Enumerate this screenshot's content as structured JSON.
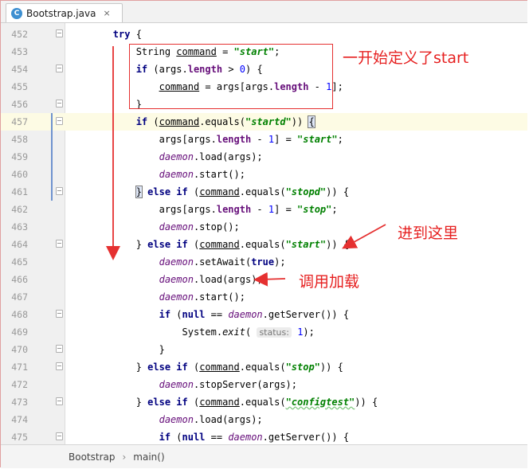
{
  "tab": {
    "title": "Bootstrap.java",
    "icon": "C",
    "close": "×"
  },
  "code_lines": [
    {
      "n": "452",
      "html": "        <span class=\"kw\">try</span> {",
      "fold": "open"
    },
    {
      "n": "453",
      "html": "            String <span class=\"u\">command</span> = <span class=\"str\">\"start\"</span>;"
    },
    {
      "n": "454",
      "html": "            <span class=\"kw\">if</span> (args.<span class=\"fld\">length</span> &gt; <span class=\"num\">0</span>) {",
      "fold": "open"
    },
    {
      "n": "455",
      "html": "                <span class=\"u\">command</span> = args[args.<span class=\"fld\">length</span> - <span class=\"num\">1</span>];"
    },
    {
      "n": "456",
      "html": "            }",
      "fold": "open"
    },
    {
      "n": "457",
      "html": "            <span class=\"kw\">if</span> (<span class=\"u\">command</span>.equals(<span class=\"str\">\"startd\"</span>)) <span class=\"bm\">{</span>",
      "fold": "open",
      "current": true
    },
    {
      "n": "458",
      "html": "                args[args.<span class=\"fld\">length</span> - <span class=\"num\">1</span>] = <span class=\"str\">\"start\"</span>;"
    },
    {
      "n": "459",
      "html": "                <span class=\"sfld\">daemon</span>.load(args);"
    },
    {
      "n": "460",
      "html": "                <span class=\"sfld\">daemon</span>.start();"
    },
    {
      "n": "461",
      "html": "            <span class=\"bm\">}</span> <span class=\"kw\">else if</span> (<span class=\"u\">command</span>.equals(<span class=\"str\">\"stopd\"</span>)) {",
      "fold": "open"
    },
    {
      "n": "462",
      "html": "                args[args.<span class=\"fld\">length</span> - <span class=\"num\">1</span>] = <span class=\"str\">\"stop\"</span>;"
    },
    {
      "n": "463",
      "html": "                <span class=\"sfld\">daemon</span>.stop();"
    },
    {
      "n": "464",
      "html": "            } <span class=\"kw\">else if</span> (<span class=\"u\">command</span>.equals(<span class=\"str\">\"start\"</span>)) {",
      "fold": "open"
    },
    {
      "n": "465",
      "html": "                <span class=\"sfld\">daemon</span>.setAwait(<span class=\"kw\">true</span>);"
    },
    {
      "n": "466",
      "html": "                <span class=\"sfld\">daemon</span>.load(args);"
    },
    {
      "n": "467",
      "html": "                <span class=\"sfld\">daemon</span>.start();"
    },
    {
      "n": "468",
      "html": "                <span class=\"kw\">if</span> (<span class=\"kw\">null</span> == <span class=\"sfld\">daemon</span>.getServer()) {",
      "fold": "open"
    },
    {
      "n": "469",
      "html": "                    System.<span style=\"font-style:italic\">exit</span>( <span class=\"hint\">status:</span> <span class=\"num\">1</span>);"
    },
    {
      "n": "470",
      "html": "                }",
      "fold": "open"
    },
    {
      "n": "471",
      "html": "            } <span class=\"kw\">else if</span> (<span class=\"u\">command</span>.equals(<span class=\"str\">\"stop\"</span>)) {",
      "fold": "open"
    },
    {
      "n": "472",
      "html": "                <span class=\"sfld\">daemon</span>.stopServer(args);"
    },
    {
      "n": "473",
      "html": "            } <span class=\"kw\">else if</span> (<span class=\"u\">command</span>.equals(<span class=\"str sq\">\"configtest\"</span>)) {",
      "fold": "open"
    },
    {
      "n": "474",
      "html": "                <span class=\"sfld\">daemon</span>.load(args);"
    },
    {
      "n": "475",
      "html": "                <span class=\"kw\">if</span> (<span class=\"kw\">null</span> == <span class=\"sfld\">daemon</span>.getServer()) {",
      "fold": "open"
    }
  ],
  "annotations": {
    "define_start": "一开始定义了start",
    "reach_here": "进到这里",
    "call_load": "调用加载"
  },
  "colors": {
    "annotation": "#e62020",
    "keyword": "#000080",
    "string": "#008000"
  },
  "breadcrumb": {
    "class_name": "Bootstrap",
    "separator": "›",
    "method": "main()"
  }
}
